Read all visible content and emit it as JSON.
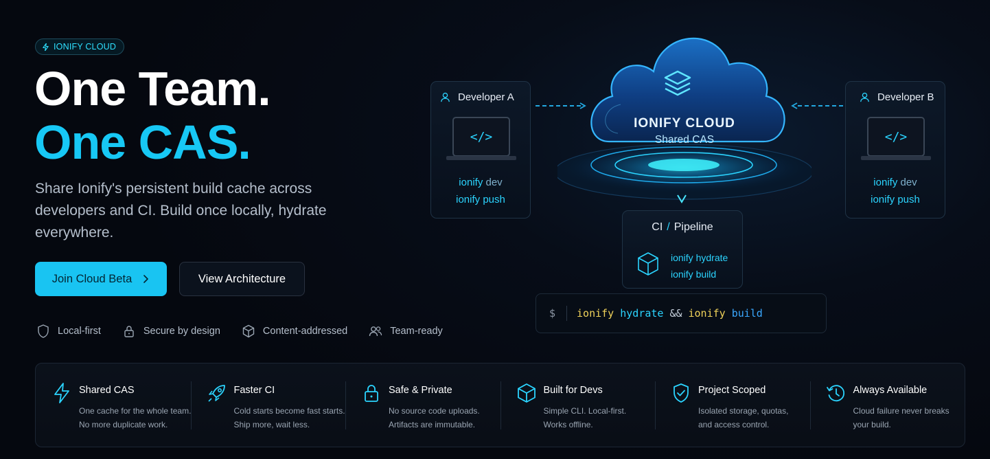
{
  "badge": {
    "label": "IONIFY CLOUD",
    "icon": "lightning-icon"
  },
  "hero": {
    "line1": "One Team.",
    "line2": "One CAS.",
    "subtitle": "Share Ionify's persistent build cache across developers and CI. Build once locally, hydrate everywhere."
  },
  "buttons": {
    "primary": "Join Cloud Beta",
    "secondary": "View Architecture"
  },
  "features": [
    {
      "label": "Local-first",
      "icon": "shield-icon"
    },
    {
      "label": "Secure by design",
      "icon": "lock-icon"
    },
    {
      "label": "Content-addressed",
      "icon": "cube-icon"
    },
    {
      "label": "Team-ready",
      "icon": "users-icon"
    }
  ],
  "diagram": {
    "developer_a": {
      "title": "Developer A",
      "cmd1_verb": "ionify",
      "cmd1_arg": "dev",
      "cmd2_verb": "ionify",
      "cmd2_arg": "push"
    },
    "developer_b": {
      "title": "Developer B",
      "cmd1_verb": "ionify",
      "cmd1_arg": "dev",
      "cmd2_verb": "ionify",
      "cmd2_arg": "push"
    },
    "cloud": {
      "title": "IONIFY CLOUD",
      "subtitle": "Shared CAS"
    },
    "ci": {
      "title_left": "CI",
      "title_sep": "/",
      "title_right": "Pipeline",
      "cmd1_verb": "ionify",
      "cmd1_arg": "hydrate",
      "cmd2_verb": "ionify",
      "cmd2_arg": "build"
    },
    "terminal": {
      "prompt": "$",
      "tokens": [
        "ionify",
        "hydrate",
        "&&",
        "ionify",
        "build"
      ]
    }
  },
  "strip": [
    {
      "title": "Shared CAS",
      "line1": "One cache for the whole team.",
      "line2": "No more duplicate work.",
      "icon": "lightning-icon"
    },
    {
      "title": "Faster CI",
      "line1": "Cold starts become fast starts.",
      "line2": "Ship more, wait less.",
      "icon": "rocket-icon"
    },
    {
      "title": "Safe & Private",
      "line1": "No source code uploads.",
      "line2": "Artifacts are immutable.",
      "icon": "lock-icon"
    },
    {
      "title": "Built for Devs",
      "line1": "Simple CLI. Local-first.",
      "line2": "Works offline.",
      "icon": "cube-icon"
    },
    {
      "title": "Project Scoped",
      "line1": "Isolated storage, quotas,",
      "line2": "and access control.",
      "icon": "shield-check-icon"
    },
    {
      "title": "Always Available",
      "line1": "Cloud failure never breaks",
      "line2": "your build.",
      "icon": "clock-icon"
    }
  ],
  "colors": {
    "accent": "#19c4f2",
    "background": "#05080f",
    "cmd_yellow": "#f0d25a",
    "cmd_blue": "#3aa8ff"
  }
}
